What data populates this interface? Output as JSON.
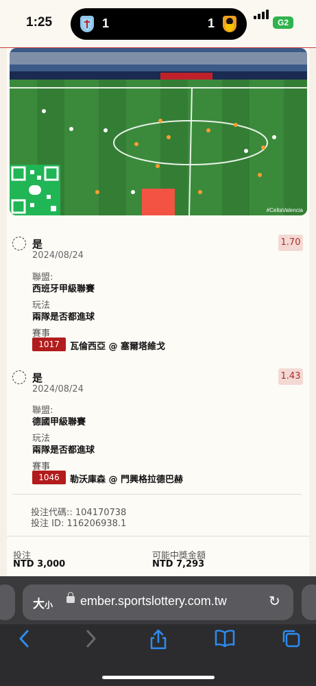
{
  "status_bar": {
    "time": "1:25",
    "home_score": "1",
    "away_score": "1",
    "battery": "G2",
    "colors": {
      "battery": "#30b24f"
    }
  },
  "video": {
    "hashtag": "#CeltaValencia",
    "ad_banner": "LALIGA"
  },
  "bets": [
    {
      "choice": "是",
      "date": "2024/08/24",
      "odds": "1.70",
      "league_label": "聯盟:",
      "league": "西班牙甲級聯賽",
      "market_label": "玩法",
      "market": "兩隊是否都進球",
      "event_label": "賽事",
      "match_id": "1017",
      "match": "瓦倫西亞 @ 塞爾塔維戈"
    },
    {
      "choice": "是",
      "date": "2024/08/24",
      "odds": "1.43",
      "league_label": "聯盟:",
      "league": "德國甲級聯賽",
      "market_label": "玩法",
      "market": "兩隊是否都進球",
      "event_label": "賽事",
      "match_id": "1046",
      "match": "勒沃庫森 @ 門興格拉德巴赫"
    }
  ],
  "ticket": {
    "code": "投注代碼:: 104170738",
    "id": "投注 ID: 116206938.1"
  },
  "summary": {
    "stake_label": "投注",
    "stake": "NTD 3,000",
    "payout_label": "可能中獎金額",
    "payout": "NTD 7,293"
  },
  "browser": {
    "text_size": "大",
    "text_size_small": "小",
    "url": "ember.sportslottery.com.tw"
  },
  "colors": {
    "accent_red": "#b21c1c",
    "odds_bg": "#f3d9d4",
    "toolbar_blue": "#2e8cf0"
  }
}
